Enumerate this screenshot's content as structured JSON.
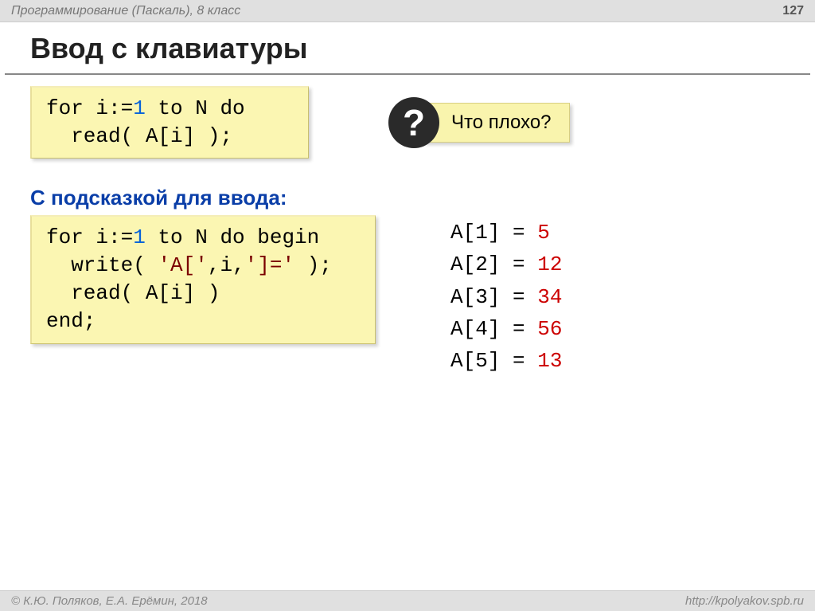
{
  "header": {
    "course": "Программирование (Паскаль), 8 класс",
    "page": "127"
  },
  "title": "Ввод с клавиатуры",
  "code1": {
    "l1a": "for i:=",
    "l1b": "1",
    "l1c": " to N do",
    "l2": "  read( A[i] );"
  },
  "callout": {
    "mark": "?",
    "text": "Что плохо?"
  },
  "subhead": "С подсказкой для ввода:",
  "code2": {
    "l1a": "for i:=",
    "l1b": "1",
    "l1c": " to N do begin",
    "l2a": "  write( ",
    "l2b": "'A['",
    "l2c": ",i,",
    "l2d": "']='",
    "l2e": " );",
    "l3": "  read( A[i] )",
    "l4": "end;"
  },
  "output": [
    {
      "label": "A[1] = ",
      "val": "5"
    },
    {
      "label": "A[2] = ",
      "val": "12"
    },
    {
      "label": "A[3] = ",
      "val": "34"
    },
    {
      "label": "A[4] = ",
      "val": "56"
    },
    {
      "label": "A[5] = ",
      "val": "13"
    }
  ],
  "footer": {
    "authors": "© К.Ю. Поляков, Е.А. Ерёмин, 2018",
    "url": "http://kpolyakov.spb.ru"
  }
}
